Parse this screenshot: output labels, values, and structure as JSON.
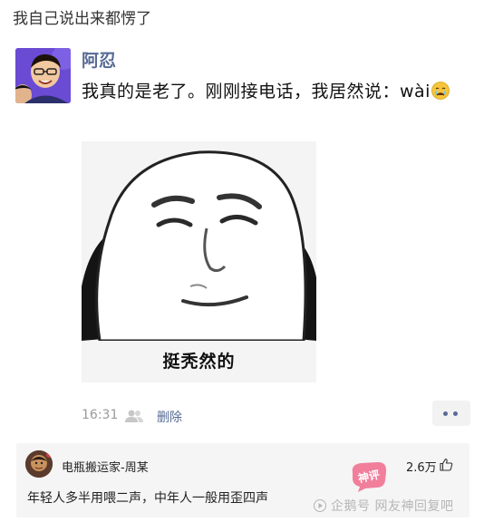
{
  "header": {
    "caption": "我自己说出来都愣了"
  },
  "post": {
    "author": "阿忍",
    "text": "我真的是老了。刚刚接电话，我居然说：wài",
    "emoji_icon": "crying-face-icon",
    "meme_caption": "挺秃然的",
    "time": "16:31",
    "delete_label": "删除",
    "more_icon": "more-dots-icon"
  },
  "comment": {
    "user": "电瓶搬运家-周某",
    "likes": "2.6万",
    "like_icon": "thumbs-up-icon",
    "text": "年轻人多半用喂二声，中年人一般用歪四声"
  },
  "watermark": {
    "badge": "神评",
    "text": "企鹅号 网友神回复吧"
  },
  "colors": {
    "link": "#576b95",
    "background": "#ffffff",
    "comment_bg": "#f5f5f5",
    "watermark_badge": "#f06a8c"
  }
}
